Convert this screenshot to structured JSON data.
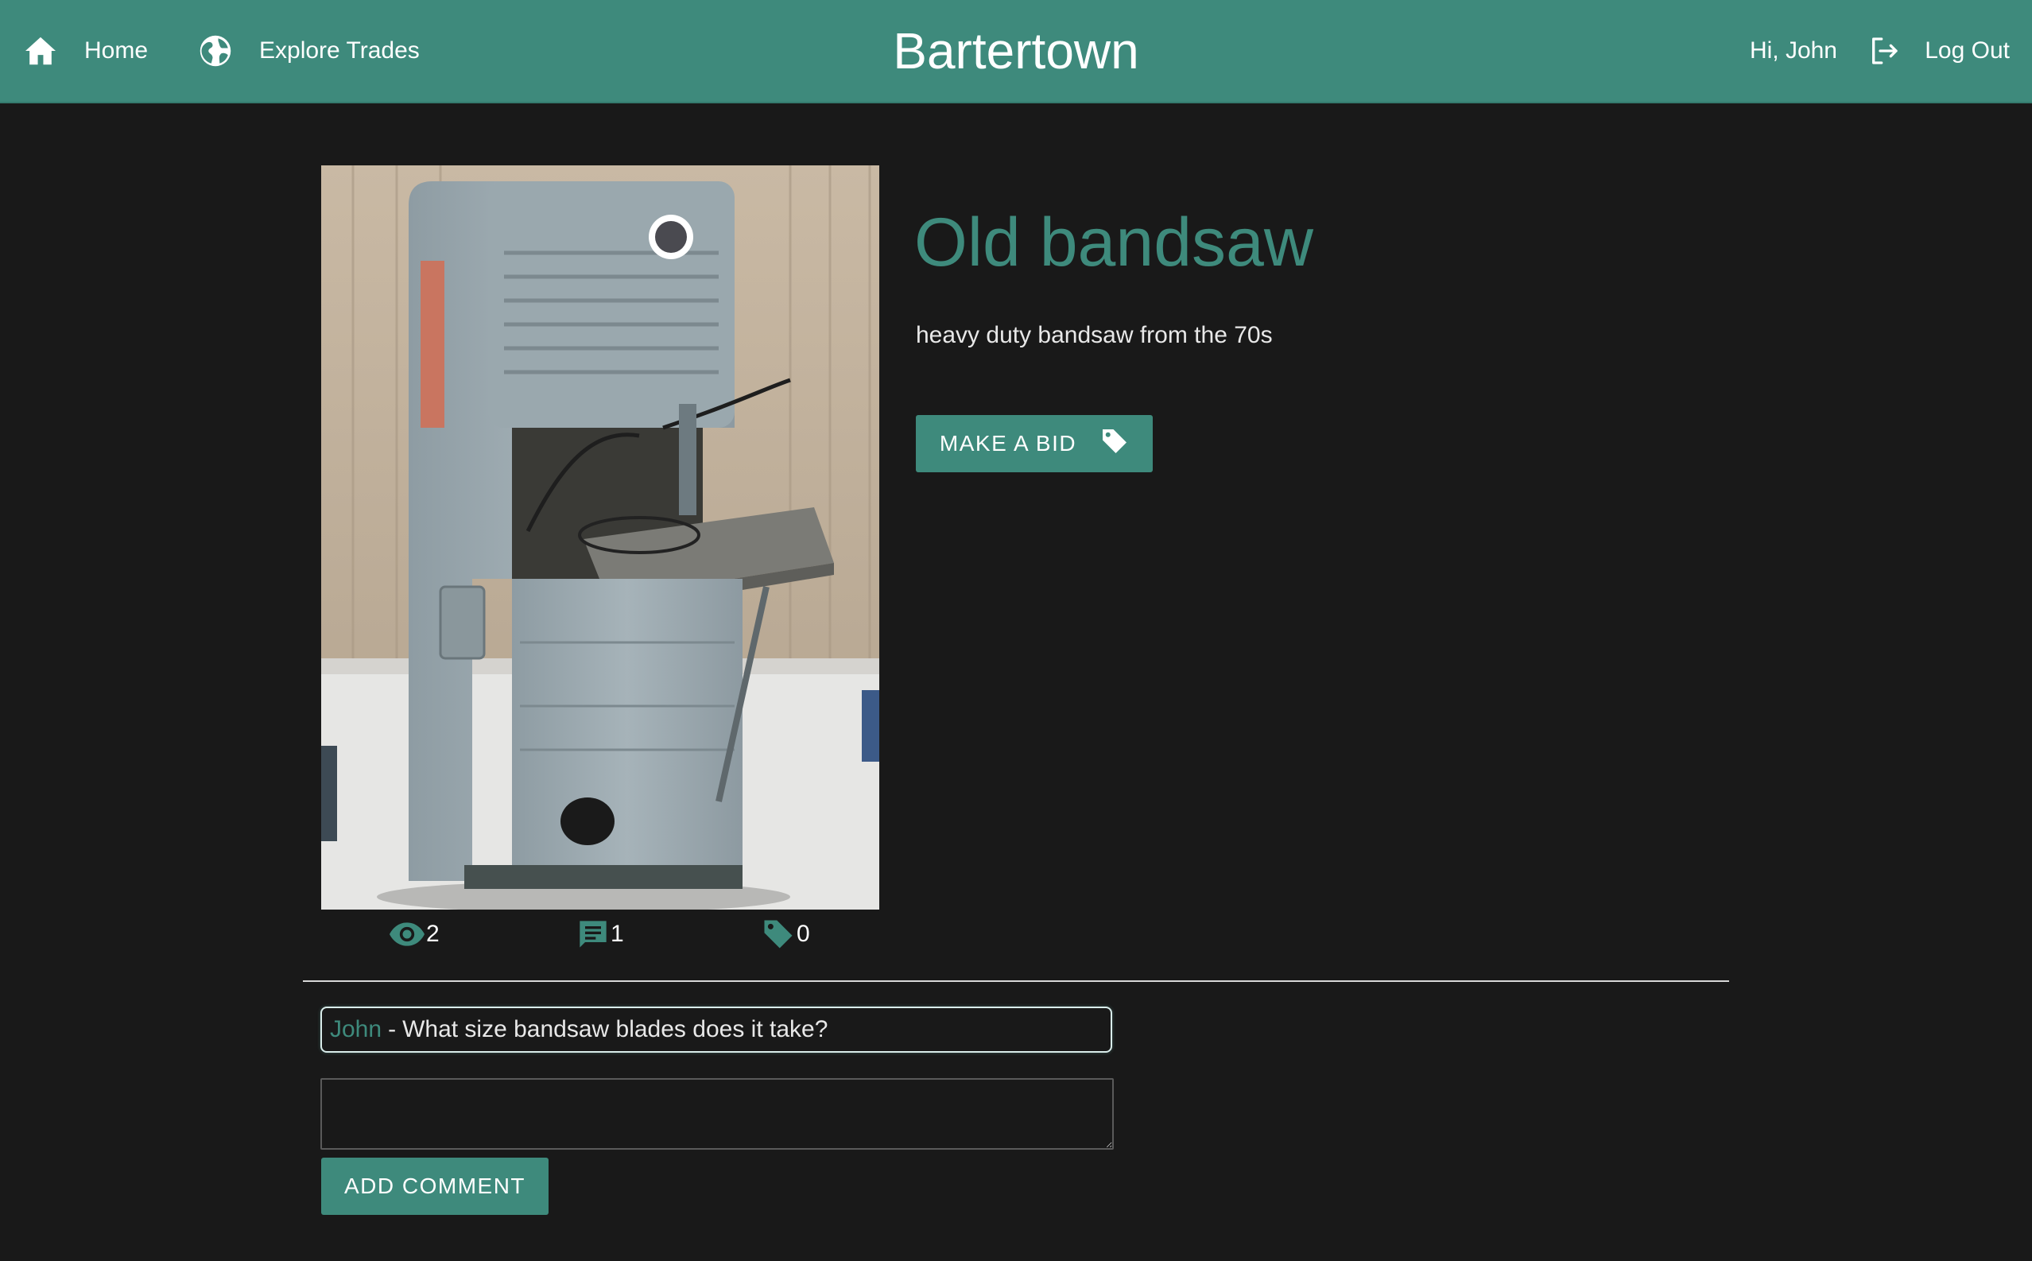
{
  "app": {
    "brand": "Bartertown"
  },
  "nav": {
    "home_label": "Home",
    "explore_label": "Explore Trades",
    "greeting": "Hi, John",
    "logout_label": "Log Out"
  },
  "trade": {
    "title": "Old bandsaw",
    "description": "heavy duty bandsaw from the 70s",
    "bid_label": "MAKE A BID",
    "stats": {
      "views": "2",
      "comments": "1",
      "bids": "0"
    }
  },
  "comments": [
    {
      "author": "John",
      "separator": "-",
      "text": "What size bandsaw blades does it take?"
    }
  ],
  "comment_form": {
    "value": "",
    "submit_label": "ADD COMMENT"
  },
  "colors": {
    "accent": "#3e8a7c",
    "background": "#191919",
    "text": "#e8e8e8"
  },
  "icons": [
    "home-icon",
    "globe-icon",
    "logout-icon",
    "tag-icon",
    "eye-icon",
    "comment-icon"
  ]
}
